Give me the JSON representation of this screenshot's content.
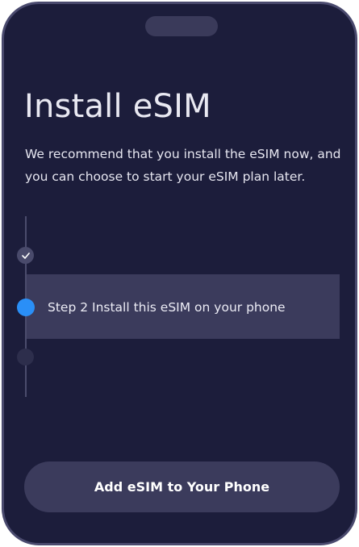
{
  "screen": {
    "title": "Install eSIM",
    "subtitle": "We recommend that you install the eSIM now, and you can choose to start your eSIM plan later."
  },
  "steps": [
    {
      "status": "completed",
      "icon": "check-icon"
    },
    {
      "status": "current",
      "label": "Step 2 Install this eSIM on your phone"
    },
    {
      "status": "upcoming"
    }
  ],
  "primary_action": {
    "label": "Add eSIM to Your Phone"
  },
  "colors": {
    "background": "#1c1d3b",
    "frame": "#4a4a6e",
    "highlight": "#3b3b5c",
    "accent": "#2a8ff7",
    "text": "#e9e9f2"
  }
}
